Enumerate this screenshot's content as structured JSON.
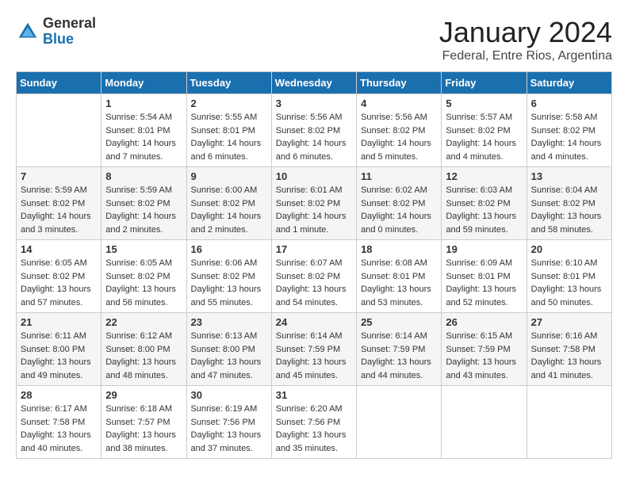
{
  "header": {
    "logo": {
      "general": "General",
      "blue": "Blue"
    },
    "month": "January 2024",
    "location": "Federal, Entre Rios, Argentina"
  },
  "weekdays": [
    "Sunday",
    "Monday",
    "Tuesday",
    "Wednesday",
    "Thursday",
    "Friday",
    "Saturday"
  ],
  "weeks": [
    [
      {
        "day": "",
        "sunrise": "",
        "sunset": "",
        "daylight": ""
      },
      {
        "day": "1",
        "sunrise": "Sunrise: 5:54 AM",
        "sunset": "Sunset: 8:01 PM",
        "daylight": "Daylight: 14 hours and 7 minutes."
      },
      {
        "day": "2",
        "sunrise": "Sunrise: 5:55 AM",
        "sunset": "Sunset: 8:01 PM",
        "daylight": "Daylight: 14 hours and 6 minutes."
      },
      {
        "day": "3",
        "sunrise": "Sunrise: 5:56 AM",
        "sunset": "Sunset: 8:02 PM",
        "daylight": "Daylight: 14 hours and 6 minutes."
      },
      {
        "day": "4",
        "sunrise": "Sunrise: 5:56 AM",
        "sunset": "Sunset: 8:02 PM",
        "daylight": "Daylight: 14 hours and 5 minutes."
      },
      {
        "day": "5",
        "sunrise": "Sunrise: 5:57 AM",
        "sunset": "Sunset: 8:02 PM",
        "daylight": "Daylight: 14 hours and 4 minutes."
      },
      {
        "day": "6",
        "sunrise": "Sunrise: 5:58 AM",
        "sunset": "Sunset: 8:02 PM",
        "daylight": "Daylight: 14 hours and 4 minutes."
      }
    ],
    [
      {
        "day": "7",
        "sunrise": "Sunrise: 5:59 AM",
        "sunset": "Sunset: 8:02 PM",
        "daylight": "Daylight: 14 hours and 3 minutes."
      },
      {
        "day": "8",
        "sunrise": "Sunrise: 5:59 AM",
        "sunset": "Sunset: 8:02 PM",
        "daylight": "Daylight: 14 hours and 2 minutes."
      },
      {
        "day": "9",
        "sunrise": "Sunrise: 6:00 AM",
        "sunset": "Sunset: 8:02 PM",
        "daylight": "Daylight: 14 hours and 2 minutes."
      },
      {
        "day": "10",
        "sunrise": "Sunrise: 6:01 AM",
        "sunset": "Sunset: 8:02 PM",
        "daylight": "Daylight: 14 hours and 1 minute."
      },
      {
        "day": "11",
        "sunrise": "Sunrise: 6:02 AM",
        "sunset": "Sunset: 8:02 PM",
        "daylight": "Daylight: 14 hours and 0 minutes."
      },
      {
        "day": "12",
        "sunrise": "Sunrise: 6:03 AM",
        "sunset": "Sunset: 8:02 PM",
        "daylight": "Daylight: 13 hours and 59 minutes."
      },
      {
        "day": "13",
        "sunrise": "Sunrise: 6:04 AM",
        "sunset": "Sunset: 8:02 PM",
        "daylight": "Daylight: 13 hours and 58 minutes."
      }
    ],
    [
      {
        "day": "14",
        "sunrise": "Sunrise: 6:05 AM",
        "sunset": "Sunset: 8:02 PM",
        "daylight": "Daylight: 13 hours and 57 minutes."
      },
      {
        "day": "15",
        "sunrise": "Sunrise: 6:05 AM",
        "sunset": "Sunset: 8:02 PM",
        "daylight": "Daylight: 13 hours and 56 minutes."
      },
      {
        "day": "16",
        "sunrise": "Sunrise: 6:06 AM",
        "sunset": "Sunset: 8:02 PM",
        "daylight": "Daylight: 13 hours and 55 minutes."
      },
      {
        "day": "17",
        "sunrise": "Sunrise: 6:07 AM",
        "sunset": "Sunset: 8:02 PM",
        "daylight": "Daylight: 13 hours and 54 minutes."
      },
      {
        "day": "18",
        "sunrise": "Sunrise: 6:08 AM",
        "sunset": "Sunset: 8:01 PM",
        "daylight": "Daylight: 13 hours and 53 minutes."
      },
      {
        "day": "19",
        "sunrise": "Sunrise: 6:09 AM",
        "sunset": "Sunset: 8:01 PM",
        "daylight": "Daylight: 13 hours and 52 minutes."
      },
      {
        "day": "20",
        "sunrise": "Sunrise: 6:10 AM",
        "sunset": "Sunset: 8:01 PM",
        "daylight": "Daylight: 13 hours and 50 minutes."
      }
    ],
    [
      {
        "day": "21",
        "sunrise": "Sunrise: 6:11 AM",
        "sunset": "Sunset: 8:00 PM",
        "daylight": "Daylight: 13 hours and 49 minutes."
      },
      {
        "day": "22",
        "sunrise": "Sunrise: 6:12 AM",
        "sunset": "Sunset: 8:00 PM",
        "daylight": "Daylight: 13 hours and 48 minutes."
      },
      {
        "day": "23",
        "sunrise": "Sunrise: 6:13 AM",
        "sunset": "Sunset: 8:00 PM",
        "daylight": "Daylight: 13 hours and 47 minutes."
      },
      {
        "day": "24",
        "sunrise": "Sunrise: 6:14 AM",
        "sunset": "Sunset: 7:59 PM",
        "daylight": "Daylight: 13 hours and 45 minutes."
      },
      {
        "day": "25",
        "sunrise": "Sunrise: 6:14 AM",
        "sunset": "Sunset: 7:59 PM",
        "daylight": "Daylight: 13 hours and 44 minutes."
      },
      {
        "day": "26",
        "sunrise": "Sunrise: 6:15 AM",
        "sunset": "Sunset: 7:59 PM",
        "daylight": "Daylight: 13 hours and 43 minutes."
      },
      {
        "day": "27",
        "sunrise": "Sunrise: 6:16 AM",
        "sunset": "Sunset: 7:58 PM",
        "daylight": "Daylight: 13 hours and 41 minutes."
      }
    ],
    [
      {
        "day": "28",
        "sunrise": "Sunrise: 6:17 AM",
        "sunset": "Sunset: 7:58 PM",
        "daylight": "Daylight: 13 hours and 40 minutes."
      },
      {
        "day": "29",
        "sunrise": "Sunrise: 6:18 AM",
        "sunset": "Sunset: 7:57 PM",
        "daylight": "Daylight: 13 hours and 38 minutes."
      },
      {
        "day": "30",
        "sunrise": "Sunrise: 6:19 AM",
        "sunset": "Sunset: 7:56 PM",
        "daylight": "Daylight: 13 hours and 37 minutes."
      },
      {
        "day": "31",
        "sunrise": "Sunrise: 6:20 AM",
        "sunset": "Sunset: 7:56 PM",
        "daylight": "Daylight: 13 hours and 35 minutes."
      },
      {
        "day": "",
        "sunrise": "",
        "sunset": "",
        "daylight": ""
      },
      {
        "day": "",
        "sunrise": "",
        "sunset": "",
        "daylight": ""
      },
      {
        "day": "",
        "sunrise": "",
        "sunset": "",
        "daylight": ""
      }
    ]
  ]
}
